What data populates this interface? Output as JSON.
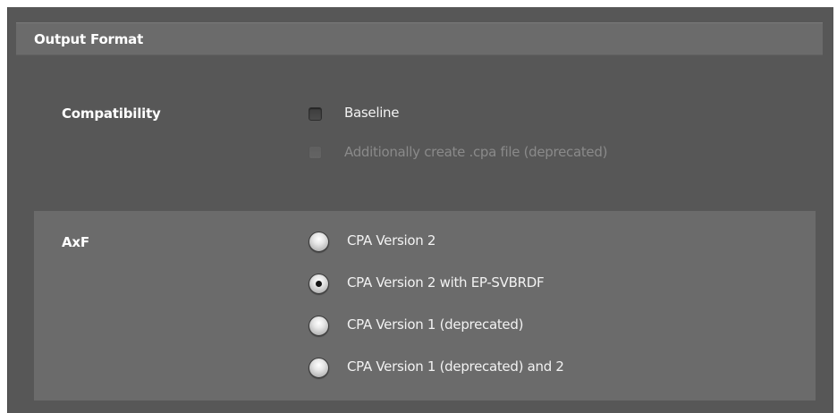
{
  "section": {
    "title": "Output Format"
  },
  "compatibility": {
    "label": "Compatibility",
    "options": [
      {
        "label": "Baseline",
        "checked": false,
        "enabled": true
      },
      {
        "label": "Additionally create .cpa file (deprecated)",
        "checked": false,
        "enabled": false
      }
    ]
  },
  "axf": {
    "label": "AxF",
    "options": [
      {
        "label": "CPA Version 2",
        "selected": false
      },
      {
        "label": "CPA Version 2 with EP-SVBRDF",
        "selected": true
      },
      {
        "label": "CPA Version 1 (deprecated)",
        "selected": false
      },
      {
        "label": "CPA Version 1 (deprecated) and 2",
        "selected": false
      }
    ]
  }
}
